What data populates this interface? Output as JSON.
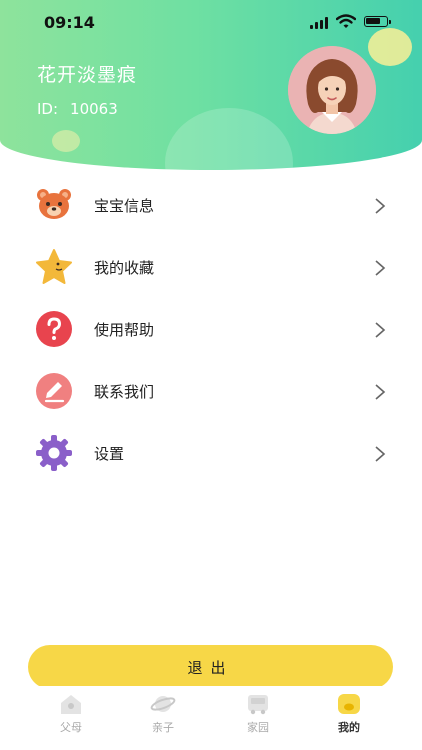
{
  "status_bar": {
    "time": "09:14"
  },
  "profile": {
    "name": "花开淡墨痕",
    "id_label": "ID:",
    "id_value": "10063"
  },
  "menu": {
    "items": [
      {
        "label": "宝宝信息",
        "icon": "bear-icon"
      },
      {
        "label": "我的收藏",
        "icon": "star-icon"
      },
      {
        "label": "使用帮助",
        "icon": "question-icon"
      },
      {
        "label": "联系我们",
        "icon": "pencil-icon"
      },
      {
        "label": "设置",
        "icon": "gear-icon"
      }
    ]
  },
  "logout_label": "退出",
  "tabbar": {
    "tabs": [
      {
        "label": "父母",
        "icon": "house-icon"
      },
      {
        "label": "亲子",
        "icon": "planet-icon"
      },
      {
        "label": "家园",
        "icon": "bus-icon"
      },
      {
        "label": "我的",
        "icon": "profile-icon",
        "active": true
      }
    ]
  },
  "colors": {
    "header_start": "#8ee39c",
    "header_end": "#45d0ae",
    "logout_button": "#f7d747",
    "bear": "#e8733d",
    "star": "#f3b83a",
    "help": "#e8444e",
    "contact": "#f08080",
    "settings": "#8a5fc9"
  }
}
